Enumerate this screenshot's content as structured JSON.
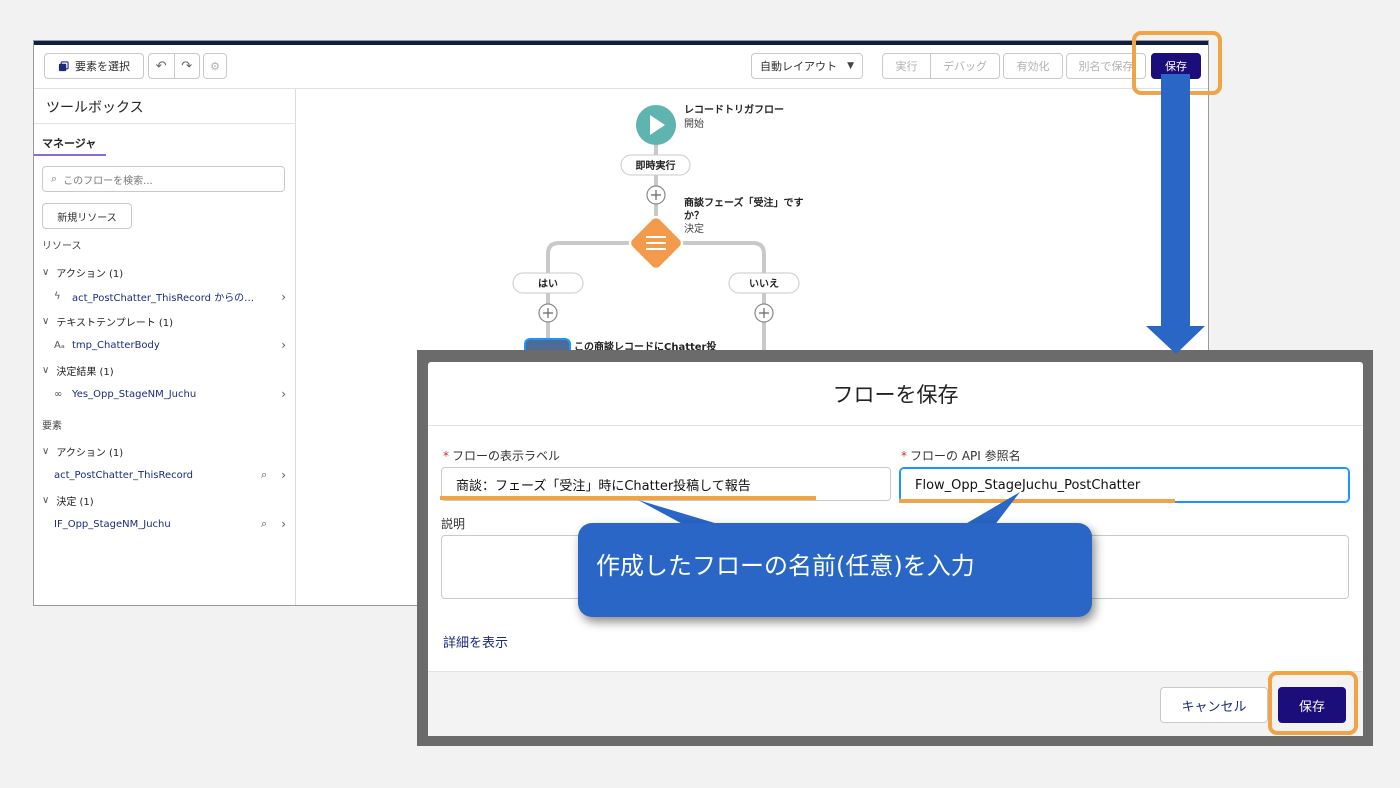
{
  "toolbar": {
    "select_elements": "要素を選択",
    "undo_icon": "↶",
    "redo_icon": "↷",
    "gear_icon": "⚙",
    "layout_select": "自動レイアウト",
    "run": "実行",
    "debug": "デバッグ",
    "activate": "有効化",
    "save_as": "別名で保存",
    "save": "保存"
  },
  "sidebar": {
    "title": "ツールボックス",
    "tab": "マネージャ",
    "search_placeholder": "このフローを検索...",
    "new_resource": "新規リソース",
    "resources_heading": "リソース",
    "elements_heading": "要素",
    "resource_groups": [
      {
        "label": "アクション (1)",
        "item": "act_PostChatter_ThisRecord からの…"
      },
      {
        "label": "テキストテンプレート (1)",
        "item": "tmp_ChatterBody"
      },
      {
        "label": "決定結果 (1)",
        "item": "Yes_Opp_StageNM_Juchu"
      }
    ],
    "element_groups": [
      {
        "label": "アクション (1)",
        "item": "act_PostChatter_ThisRecord"
      },
      {
        "label": "決定 (1)",
        "item": "IF_Opp_StageNM_Juchu"
      }
    ]
  },
  "canvas": {
    "start_title": "レコードトリガフロー",
    "start_sub": "開始",
    "immediate": "即時実行",
    "decision_title_1": "商談フェーズ「受注」です",
    "decision_title_2": "か？",
    "decision_sub": "決定",
    "yes_branch": "はい",
    "no_branch": "いいえ",
    "action_title": "この商談レコードにChatter投"
  },
  "modal": {
    "title": "フローを保存",
    "label_field_label": "フローの表示ラベル",
    "label_field_value": "商談：フェーズ「受注」時にChatter投稿して報告",
    "api_field_label": "フローの API 参照名",
    "api_field_value": "Flow_Opp_StageJuchu_PostChatter",
    "description_label": "説明",
    "description_value": "",
    "show_details": "詳細を表示",
    "cancel": "キャンセル",
    "save": "保存"
  },
  "annotation": {
    "callout_text": "作成したフローの名前(任意)を入力"
  },
  "colors": {
    "highlight": "#f0a448",
    "arrow": "#2966c5",
    "brand": "#1b0d7a",
    "start_node": "#5fb4b0",
    "decision_node": "#f39a4c"
  }
}
